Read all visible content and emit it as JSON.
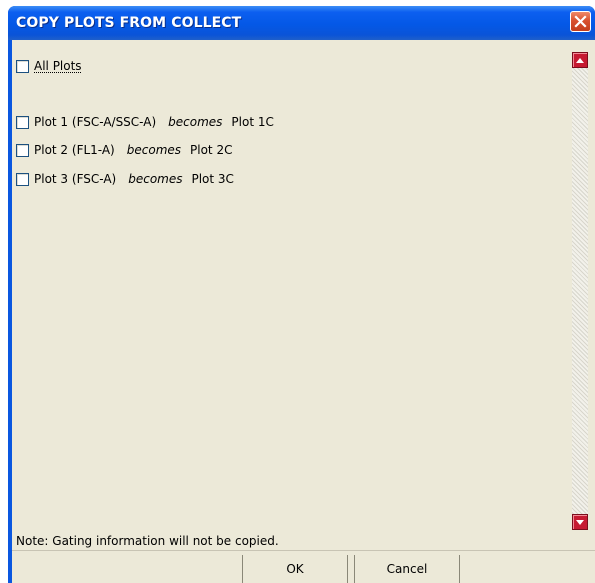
{
  "dialog": {
    "title": "COPY PLOTS FROM COLLECT"
  },
  "list": {
    "all_plots_label": "All Plots",
    "items": [
      {
        "source": "Plot 1 (FSC-A/SSC-A)",
        "connector": "becomes",
        "target": "Plot 1C",
        "checked": false
      },
      {
        "source": "Plot 2 (FL1-A)",
        "connector": "becomes",
        "target": "Plot 2C",
        "checked": false
      },
      {
        "source": "Plot 3 (FSC-A)",
        "connector": "becomes",
        "target": "Plot 3C",
        "checked": false
      }
    ]
  },
  "footer": {
    "note": "Note: Gating information will not be copied.",
    "ok_label": "OK",
    "cancel_label": "Cancel"
  },
  "icons": {
    "close": "close-icon",
    "scroll_up": "arrow-up-icon",
    "scroll_down": "arrow-down-icon"
  },
  "colors": {
    "titlebar": "#0458e6",
    "client": "#ece9d8",
    "close_button": "#d8512f",
    "scroll_buttons": "#c61a32"
  }
}
